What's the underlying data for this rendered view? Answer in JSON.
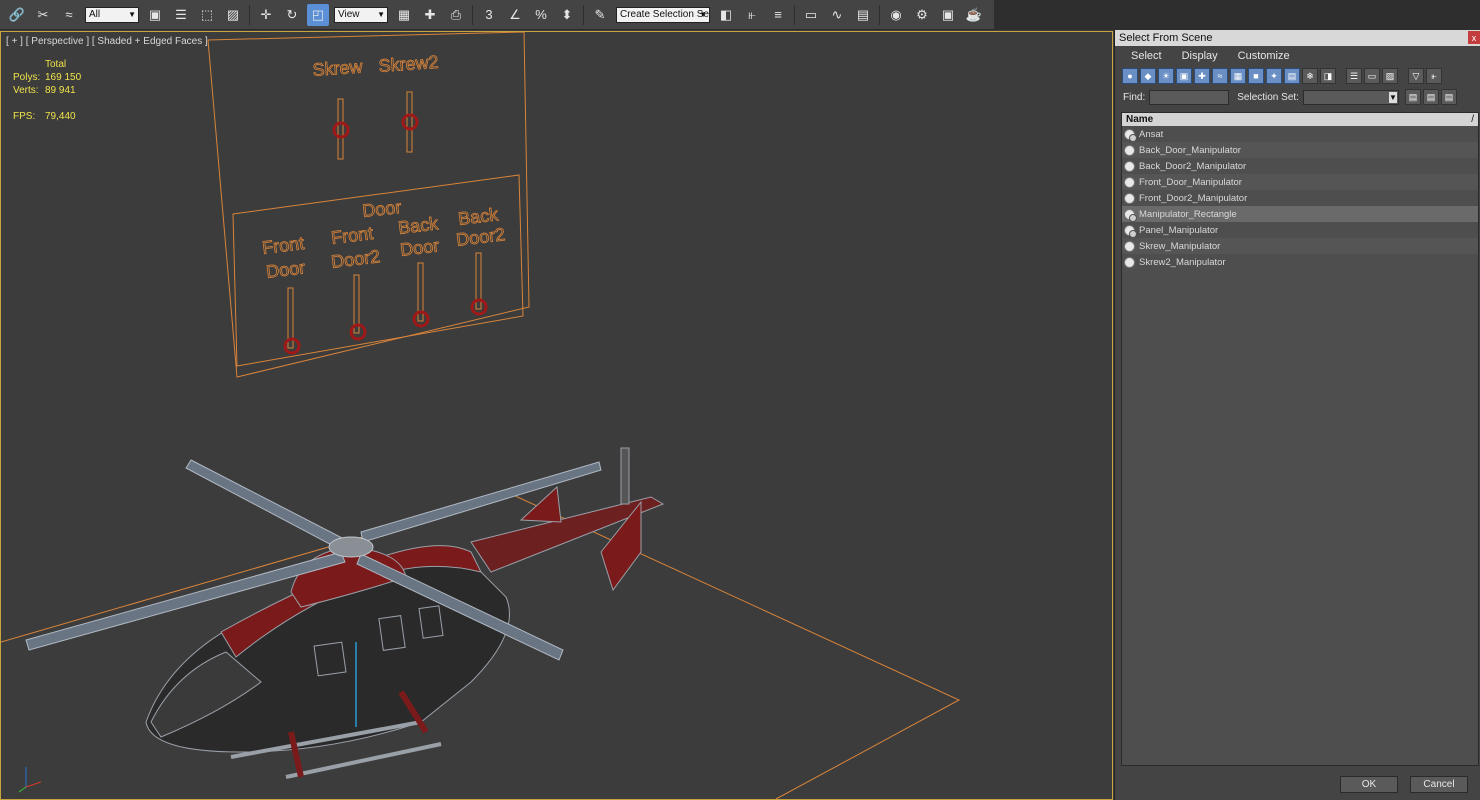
{
  "toolbar": {
    "filter_value": "All",
    "refcoord_value": "View",
    "selection_set_placeholder": "Create Selection Se",
    "snap_label": "3",
    "percent_label": "%"
  },
  "viewport": {
    "label": "[ + ] [ Perspective ] [ Shaded + Edged Faces ]",
    "stats": {
      "total_label": "Total",
      "polys_label": "Polys:",
      "polys_value": "169 150",
      "verts_label": "Verts:",
      "verts_value": "89 941",
      "fps_label": "FPS:",
      "fps_value": "79,440"
    },
    "panel_labels": {
      "skrew": "Skrew",
      "skrew2": "Skrew2",
      "door_title": "Door",
      "front_door_1": "Front",
      "front_door_2": "Door",
      "front_door2_1": "Front",
      "front_door2_2": "Door2",
      "back_door_1": "Back",
      "back_door_2": "Door",
      "back_door2_1": "Back",
      "back_door2_2": "Door2"
    },
    "colors": {
      "wire_orange": "#d9843a",
      "slider_red": "#a01818",
      "heli_red": "#7a1a1a",
      "heli_grey": "#9aa0a8"
    }
  },
  "dialog": {
    "title": "Select From Scene",
    "close": "x",
    "menu": [
      "Select",
      "Display",
      "Customize"
    ],
    "find_label": "Find:",
    "selection_set_label": "Selection Set:",
    "column_header": "Name",
    "sort_indicator": "/",
    "items": [
      {
        "name": "Ansat",
        "icon": "group-icon"
      },
      {
        "name": "Back_Door_Manipulator",
        "icon": "object-icon"
      },
      {
        "name": "Back_Door2_Manipulator",
        "icon": "object-icon"
      },
      {
        "name": "Front_Door_Manipulator",
        "icon": "object-icon"
      },
      {
        "name": "Front_Door2_Manipulator",
        "icon": "object-icon"
      },
      {
        "name": "Manipulator_Rectangle",
        "icon": "group-icon"
      },
      {
        "name": "Panel_Manipulator",
        "icon": "group-icon"
      },
      {
        "name": "Skrew_Manipulator",
        "icon": "object-icon"
      },
      {
        "name": "Skrew2_Manipulator",
        "icon": "object-icon"
      }
    ],
    "ok_label": "OK",
    "cancel_label": "Cancel"
  }
}
